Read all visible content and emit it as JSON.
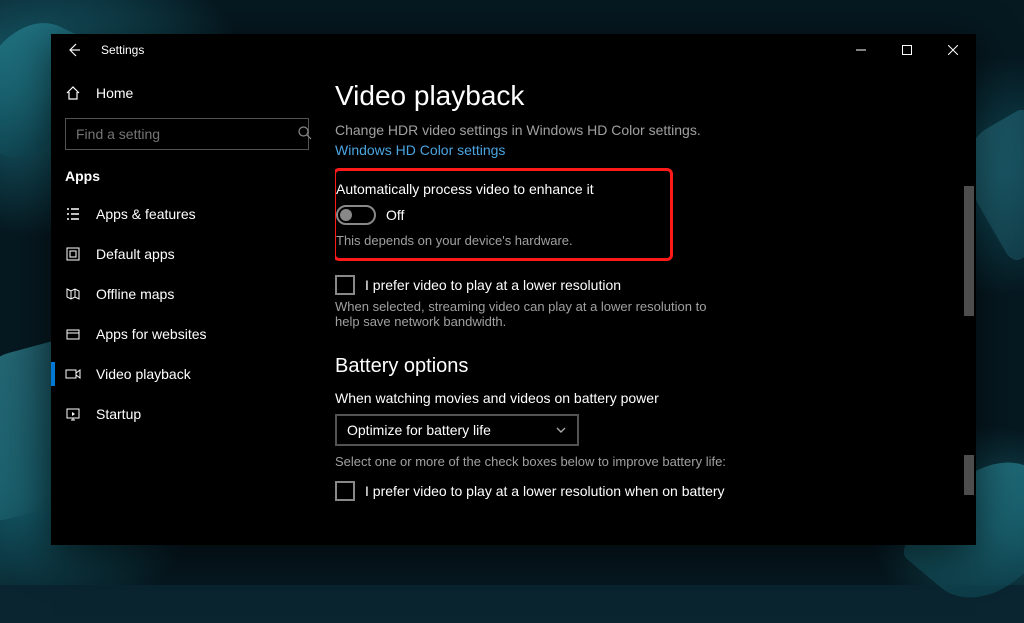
{
  "app_title": "Settings",
  "home_label": "Home",
  "search_placeholder": "Find a setting",
  "category": "Apps",
  "nav": [
    {
      "label": "Apps & features"
    },
    {
      "label": "Default apps"
    },
    {
      "label": "Offline maps"
    },
    {
      "label": "Apps for websites"
    },
    {
      "label": "Video playback"
    },
    {
      "label": "Startup"
    }
  ],
  "page": {
    "title": "Video playback",
    "hdr_desc": "Change HDR video settings in Windows HD Color settings.",
    "hdr_link": "Windows HD Color settings",
    "auto_enhance": {
      "label": "Automatically process video to enhance it",
      "state": "Off",
      "hint": "This depends on your device's hardware."
    },
    "lowres": {
      "label": "I prefer video to play at a lower resolution",
      "hint": "When selected, streaming video can play at a lower resolution to help save network bandwidth."
    },
    "battery": {
      "title": "Battery options",
      "label": "When watching movies and videos on battery power",
      "dropdown": "Optimize for battery life",
      "hint": "Select one or more of the check boxes below to improve battery life:",
      "lowres_label": "I prefer video to play at a lower resolution when on battery"
    }
  }
}
